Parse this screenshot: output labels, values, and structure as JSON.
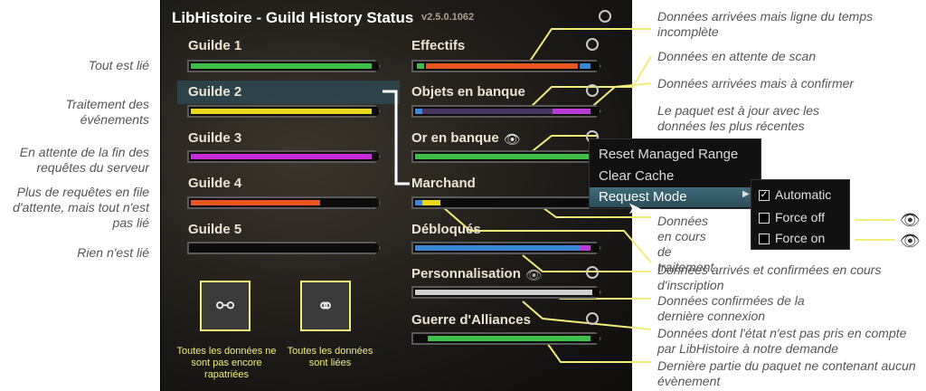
{
  "window": {
    "title": "LibHistoire - Guild History Status",
    "version": "v2.5.0.1062"
  },
  "guilds": [
    {
      "label": "Guilde 1",
      "color": "#3dbf4a",
      "fill": 1.0
    },
    {
      "label": "Guilde 2",
      "color": "#e8d71f",
      "fill": 1.0
    },
    {
      "label": "Guilde 3",
      "color": "#c72ad7",
      "fill": 1.0
    },
    {
      "label": "Guilde 4",
      "color": "#e8571f",
      "fill": 0.68
    },
    {
      "label": "Guilde 5",
      "color": "#333333",
      "fill": 0.0
    }
  ],
  "categories": [
    {
      "label": "Effectifs",
      "eye": false
    },
    {
      "label": "Objets en banque",
      "eye": false
    },
    {
      "label": "Or en banque",
      "eye": true
    },
    {
      "label": "Marchand",
      "eye": false
    },
    {
      "label": "Débloqués",
      "eye": false
    },
    {
      "label": "Personnalisation",
      "eye": "slash"
    },
    {
      "label": "Guerre d'Alliances",
      "eye": false
    }
  ],
  "left_notes": [
    "Tout est lié",
    "Traitement des événements",
    "En attente de la fin des requêtes du serveur",
    "Plus de requêtes en file d'attente, mais tout n'est pas lié",
    "Rien n'est lié"
  ],
  "right_notes": [
    "Données arrivées mais ligne du temps incomplète",
    "Données en attente de scan",
    "Données arrivées mais à confirmer",
    "Le paquet est à jour avec les données les plus récentes",
    "Données en cours de traitement",
    "Données arrivés et confirmées en cours d'inscription",
    "Données confirmées de la dernière connexion",
    "Données dont l'état n'est pas pris en compte par LibHistoire à notre demande",
    "Dernière partie du paquet ne contenant aucun évènement"
  ],
  "context_menu": {
    "items": [
      "Reset Managed Range",
      "Clear Cache",
      "Request Mode"
    ],
    "submenu": [
      {
        "label": "Automatic",
        "checked": true
      },
      {
        "label": "Force off",
        "checked": false
      },
      {
        "label": "Force on",
        "checked": false
      }
    ]
  },
  "icon_captions": {
    "not_all_fetched": "Toutes les données ne sont pas encore rapatriées",
    "all_linked": "Toutes les données sont liées"
  },
  "colors": {
    "accent": "#f2ec79",
    "green": "#3dbf4a",
    "orange": "#e8571f",
    "blue": "#3a87d8",
    "purple": "#b83ad7",
    "gray": "#cfcfcf"
  }
}
